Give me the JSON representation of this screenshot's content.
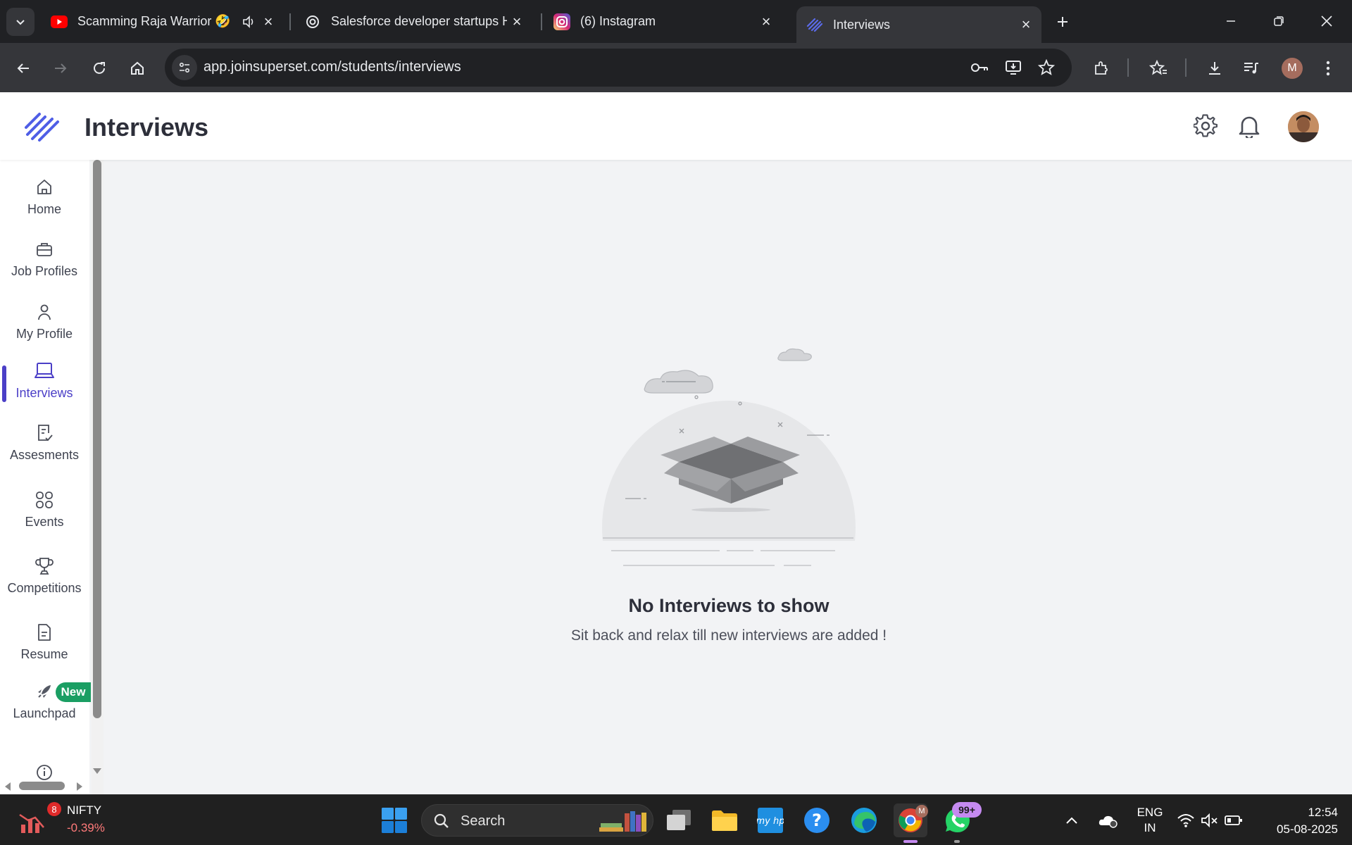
{
  "browser": {
    "tabs": [
      {
        "title": "Scamming Raja Warrior 🤣",
        "favicon": "youtube-icon",
        "audio": true
      },
      {
        "title": "Salesforce developer startups H",
        "favicon": "openai-icon"
      },
      {
        "title": "(6) Instagram",
        "favicon": "instagram-icon"
      },
      {
        "title": "Interviews",
        "favicon": "superset-icon",
        "active": true
      }
    ],
    "url": "app.joinsuperset.com/students/interviews",
    "profile_initial": "M"
  },
  "app": {
    "page_title": "Interviews",
    "nav": [
      {
        "label": "Home",
        "icon": "home-icon"
      },
      {
        "label": "Job Profiles",
        "icon": "briefcase-icon"
      },
      {
        "label": "My Profile",
        "icon": "user-icon"
      },
      {
        "label": "Interviews",
        "icon": "laptop-icon",
        "active": true
      },
      {
        "label": "Assesments",
        "icon": "assessment-icon"
      },
      {
        "label": "Events",
        "icon": "grid-icon"
      },
      {
        "label": "Competitions",
        "icon": "trophy-icon"
      },
      {
        "label": "Resume",
        "icon": "document-icon"
      },
      {
        "label": "Launchpad",
        "icon": "rocket-icon",
        "badge": "New"
      }
    ],
    "empty_state": {
      "title": "No Interviews to show",
      "subtitle": "Sit back and relax till new interviews are added !"
    },
    "colors": {
      "accent": "#4b3fc7",
      "badge_green": "#1a9e63"
    }
  },
  "taskbar": {
    "stock_name": "NIFTY",
    "stock_change": "-0.39%",
    "stock_badge": "8",
    "search_label": "Search",
    "whatsapp_badge": "99+",
    "chrome_badge": "M",
    "lang_line1": "ENG",
    "lang_line2": "IN",
    "time": "12:54",
    "date": "05-08-2025"
  }
}
